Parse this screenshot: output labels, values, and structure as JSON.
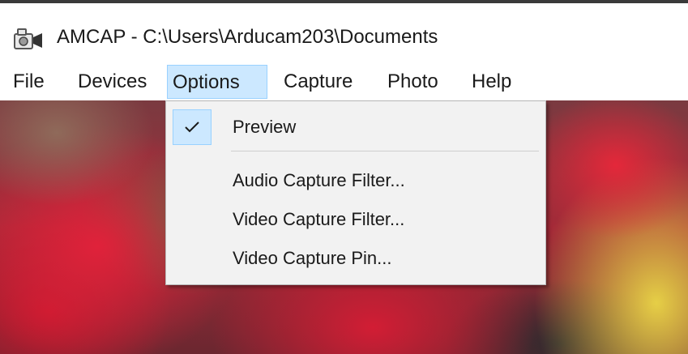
{
  "window": {
    "title": "AMCAP - C:\\Users\\Arducam203\\Documents",
    "app_icon": "camera-icon"
  },
  "menubar": {
    "items": [
      {
        "label": "File"
      },
      {
        "label": "Devices"
      },
      {
        "label": "Options",
        "active": true
      },
      {
        "label": "Capture"
      },
      {
        "label": "Photo"
      },
      {
        "label": "Help"
      }
    ]
  },
  "options_menu": {
    "items": [
      {
        "label": "Preview",
        "checked": true
      },
      {
        "label": "Audio Capture Filter..."
      },
      {
        "label": "Video Capture Filter..."
      },
      {
        "label": "Video Capture Pin..."
      }
    ],
    "check_icon": "checkmark-icon"
  },
  "colors": {
    "menu_highlight": "#cce8ff",
    "menu_highlight_border": "#99d1ff",
    "menu_background": "#f2f2f2"
  }
}
